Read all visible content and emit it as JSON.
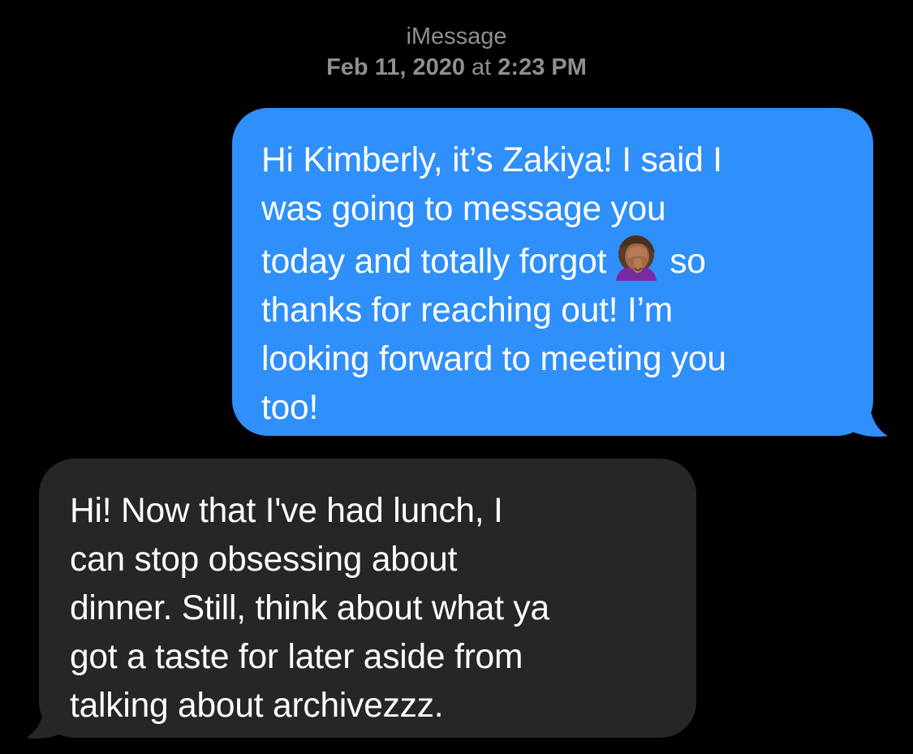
{
  "header": {
    "service": "iMessage",
    "date": "Feb 11, 2020",
    "at": "at",
    "time": "2:23 PM"
  },
  "messages": [
    {
      "direction": "sent",
      "color": "#2f8ffb",
      "lines": [
        "Hi Kimberly, it’s Zakiya! I said I",
        "was going to message you",
        "today and totally forgot",
        "so",
        "thanks for reaching out! I’m",
        "looking forward to meeting you",
        "too!"
      ],
      "emoji": "woman-facepalming-icon"
    },
    {
      "direction": "received",
      "color": "#262629",
      "lines": [
        "Hi! Now that I've had lunch, I",
        "can stop obsessing about",
        "dinner. Still, think about what ya",
        "got a taste for later aside from",
        "talking about archivezzz."
      ]
    }
  ]
}
